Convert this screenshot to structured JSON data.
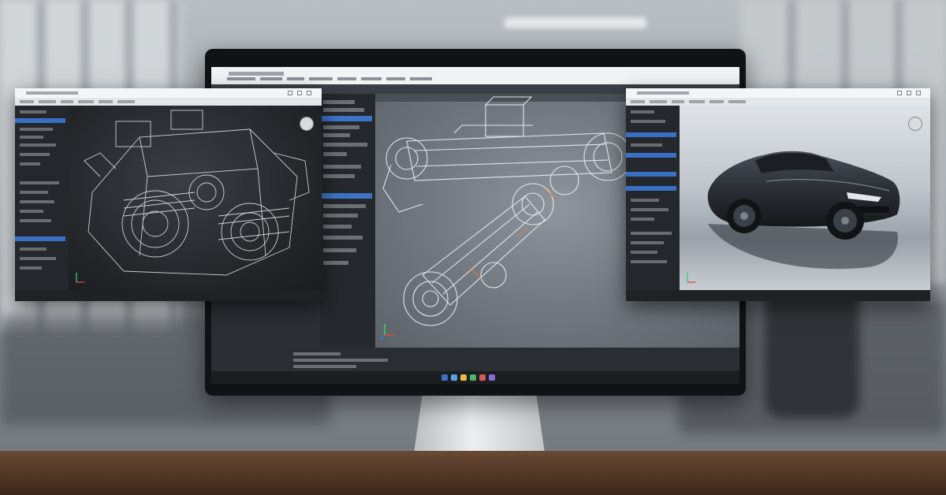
{
  "scene": {
    "description_free": true
  },
  "icons": {
    "main_viewport": "robotic-arm-wireframe-icon",
    "left_viewport": "engine-wireframe-icon",
    "right_viewport": "sports-car-render-icon",
    "axis": "xyz-axis-icon",
    "view_cube": "view-cube-icon"
  },
  "colors": {
    "selection_blue": "#3d73c7",
    "panel_dark": "#2a2d31",
    "viewport_grey": "#6f767d",
    "wire_white": "#eef1f4",
    "accent_orange": "#d9803e"
  }
}
